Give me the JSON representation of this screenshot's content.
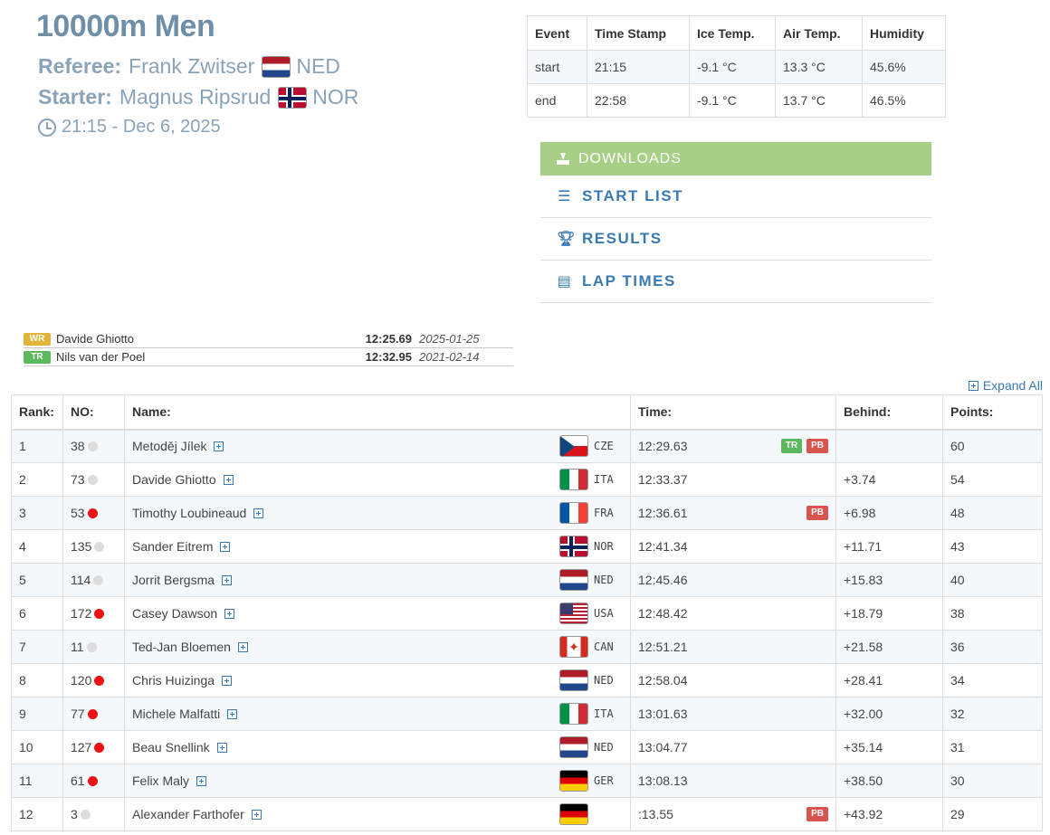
{
  "event": {
    "title": "10000m Men",
    "referee_label": "Referee:",
    "referee_name": "Frank Zwitser",
    "referee_country": "NED",
    "starter_label": "Starter:",
    "starter_name": "Magnus Ripsrud",
    "starter_country": "NOR",
    "datetime": "21:15 - Dec 6, 2025"
  },
  "conditions": {
    "headers": [
      "Event",
      "Time Stamp",
      "Ice Temp.",
      "Air Temp.",
      "Humidity"
    ],
    "rows": [
      [
        "start",
        "21:15",
        "-9.1 °C",
        "13.3 °C",
        "45.6%"
      ],
      [
        "end",
        "22:58",
        "-9.1 °C",
        "13.7 °C",
        "46.5%"
      ]
    ]
  },
  "downloads": {
    "header": "DOWNLOADS",
    "items": [
      "START LIST",
      "RESULTS",
      "LAP TIMES"
    ]
  },
  "records": [
    {
      "tag": "WR",
      "name": "Davide Ghiotto",
      "time": "12:25.69",
      "date": "2025-01-25"
    },
    {
      "tag": "TR",
      "name": "Nils van der Poel",
      "time": "12:32.95",
      "date": "2021-02-14"
    }
  ],
  "expand_all": "Expand All",
  "results": {
    "headers": [
      "Rank:",
      "NO:",
      "Name:",
      "Time:",
      "Behind:",
      "Points:"
    ],
    "rows": [
      {
        "rank": "1",
        "no": "38",
        "dot": "grey",
        "name": "Metoděj Jílek",
        "flag": "cze",
        "nat": "CZE",
        "time": "12:29.63",
        "badges": [
          "TR",
          "PB"
        ],
        "behind": "",
        "points": "60"
      },
      {
        "rank": "2",
        "no": "73",
        "dot": "grey",
        "name": "Davide Ghiotto",
        "flag": "ita",
        "nat": "ITA",
        "time": "12:33.37",
        "badges": [],
        "behind": "+3.74",
        "points": "54"
      },
      {
        "rank": "3",
        "no": "53",
        "dot": "red",
        "name": "Timothy Loubineaud",
        "flag": "fra",
        "nat": "FRA",
        "time": "12:36.61",
        "badges": [
          "PB"
        ],
        "behind": "+6.98",
        "points": "48"
      },
      {
        "rank": "4",
        "no": "135",
        "dot": "grey",
        "name": "Sander Eitrem",
        "flag": "nor",
        "nat": "NOR",
        "time": "12:41.34",
        "badges": [],
        "behind": "+11.71",
        "points": "43"
      },
      {
        "rank": "5",
        "no": "114",
        "dot": "grey",
        "name": "Jorrit Bergsma",
        "flag": "ned",
        "nat": "NED",
        "time": "12:45.46",
        "badges": [],
        "behind": "+15.83",
        "points": "40"
      },
      {
        "rank": "6",
        "no": "172",
        "dot": "red",
        "name": "Casey Dawson",
        "flag": "usa",
        "nat": "USA",
        "time": "12:48.42",
        "badges": [],
        "behind": "+18.79",
        "points": "38"
      },
      {
        "rank": "7",
        "no": "11",
        "dot": "grey",
        "name": "Ted-Jan Bloemen",
        "flag": "can",
        "nat": "CAN",
        "time": "12:51.21",
        "badges": [],
        "behind": "+21.58",
        "points": "36"
      },
      {
        "rank": "8",
        "no": "120",
        "dot": "red",
        "name": "Chris Huizinga",
        "flag": "ned",
        "nat": "NED",
        "time": "12:58.04",
        "badges": [],
        "behind": "+28.41",
        "points": "34"
      },
      {
        "rank": "9",
        "no": "77",
        "dot": "red",
        "name": "Michele Malfatti",
        "flag": "ita",
        "nat": "ITA",
        "time": "13:01.63",
        "badges": [],
        "behind": "+32.00",
        "points": "32"
      },
      {
        "rank": "10",
        "no": "127",
        "dot": "red",
        "name": "Beau Snellink",
        "flag": "ned",
        "nat": "NED",
        "time": "13:04.77",
        "badges": [],
        "behind": "+35.14",
        "points": "31"
      },
      {
        "rank": "11",
        "no": "61",
        "dot": "red",
        "name": "Felix Maly",
        "flag": "ger",
        "nat": "GER",
        "time": "13:08.13",
        "badges": [],
        "behind": "+38.50",
        "points": "30"
      },
      {
        "rank": "12",
        "no": "3",
        "dot": "grey",
        "name": "Alexander Farthofer",
        "flag": "aut",
        "nat": "",
        "time": ":13.55",
        "badges": [
          "PB"
        ],
        "behind": "+43.92",
        "points": "29"
      }
    ]
  }
}
